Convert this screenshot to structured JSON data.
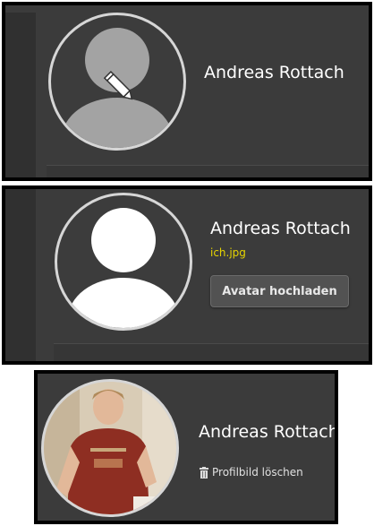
{
  "panels": [
    {
      "name": "Andreas Rottach",
      "state": "hover",
      "icon": "pencil-icon"
    },
    {
      "name": "Andreas Rottach",
      "filename": "ich.jpg",
      "upload_label": "Avatar hochladen"
    },
    {
      "name": "Andreas Rottach",
      "delete_label": "Profilbild löschen",
      "delete_icon": "trash-icon"
    }
  ],
  "colors": {
    "panel_bg": "#3b3b3b",
    "border": "#000000",
    "filename": "#e6d400",
    "avatar_ring": "#d6d6d6"
  }
}
